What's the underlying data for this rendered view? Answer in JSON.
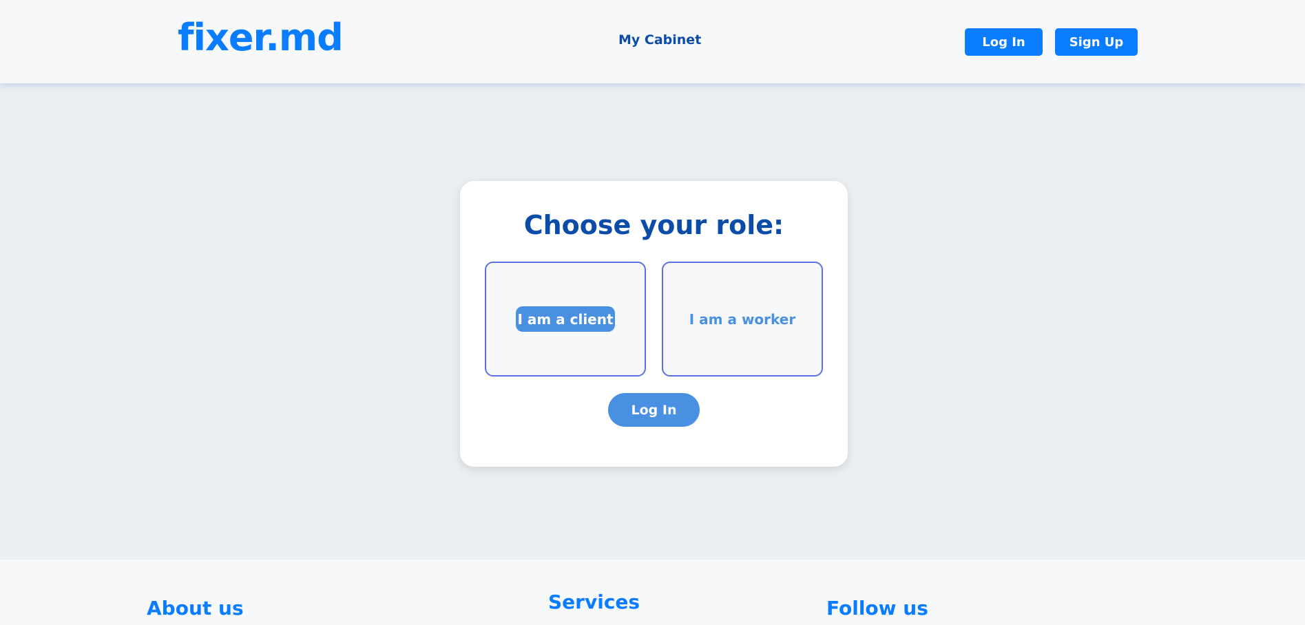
{
  "header": {
    "logo": "fixer.md",
    "nav_cabinet": "My Cabinet",
    "login_label": "Log In",
    "signup_label": "Sign Up"
  },
  "role_card": {
    "title": "Choose your role:",
    "options": [
      {
        "label": "I am a client",
        "selected": true
      },
      {
        "label": "I am a worker",
        "selected": false
      }
    ],
    "login_label": "Log In"
  },
  "footer": {
    "headings": [
      "About us",
      "Services",
      "Follow us"
    ]
  },
  "colors": {
    "brand_blue": "#0a7cff",
    "dark_blue": "#0b4ca8",
    "accent_blue": "#4a90e2",
    "role_border": "#5b6fe6",
    "page_background": "#eceff1",
    "header_background": "#f7f8fa"
  }
}
